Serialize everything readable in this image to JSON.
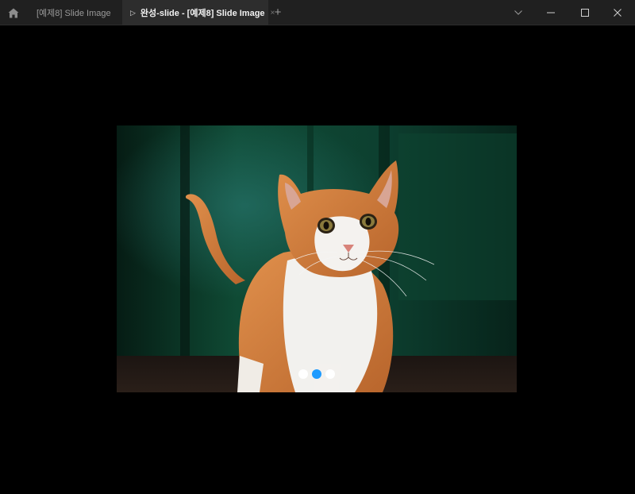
{
  "window": {
    "tabs": [
      {
        "label": "[예제8] Slide Image",
        "active": false
      },
      {
        "label": "완성-slide - [예제8] Slide Image",
        "active": true
      }
    ],
    "close_tab_glyph": "×",
    "new_tab_glyph": "+"
  },
  "slider": {
    "image_subject": "orange and white kitten in front of a green door",
    "slide_count": 3,
    "active_index": 1,
    "indicator_active_color": "#1e9bff",
    "indicator_inactive_color": "#ffffff"
  },
  "icons": {
    "home": "home-icon",
    "play": "play-icon",
    "dropdown": "chevron-down-icon",
    "minimize": "minimize-icon",
    "maximize": "maximize-icon",
    "close": "close-icon"
  }
}
